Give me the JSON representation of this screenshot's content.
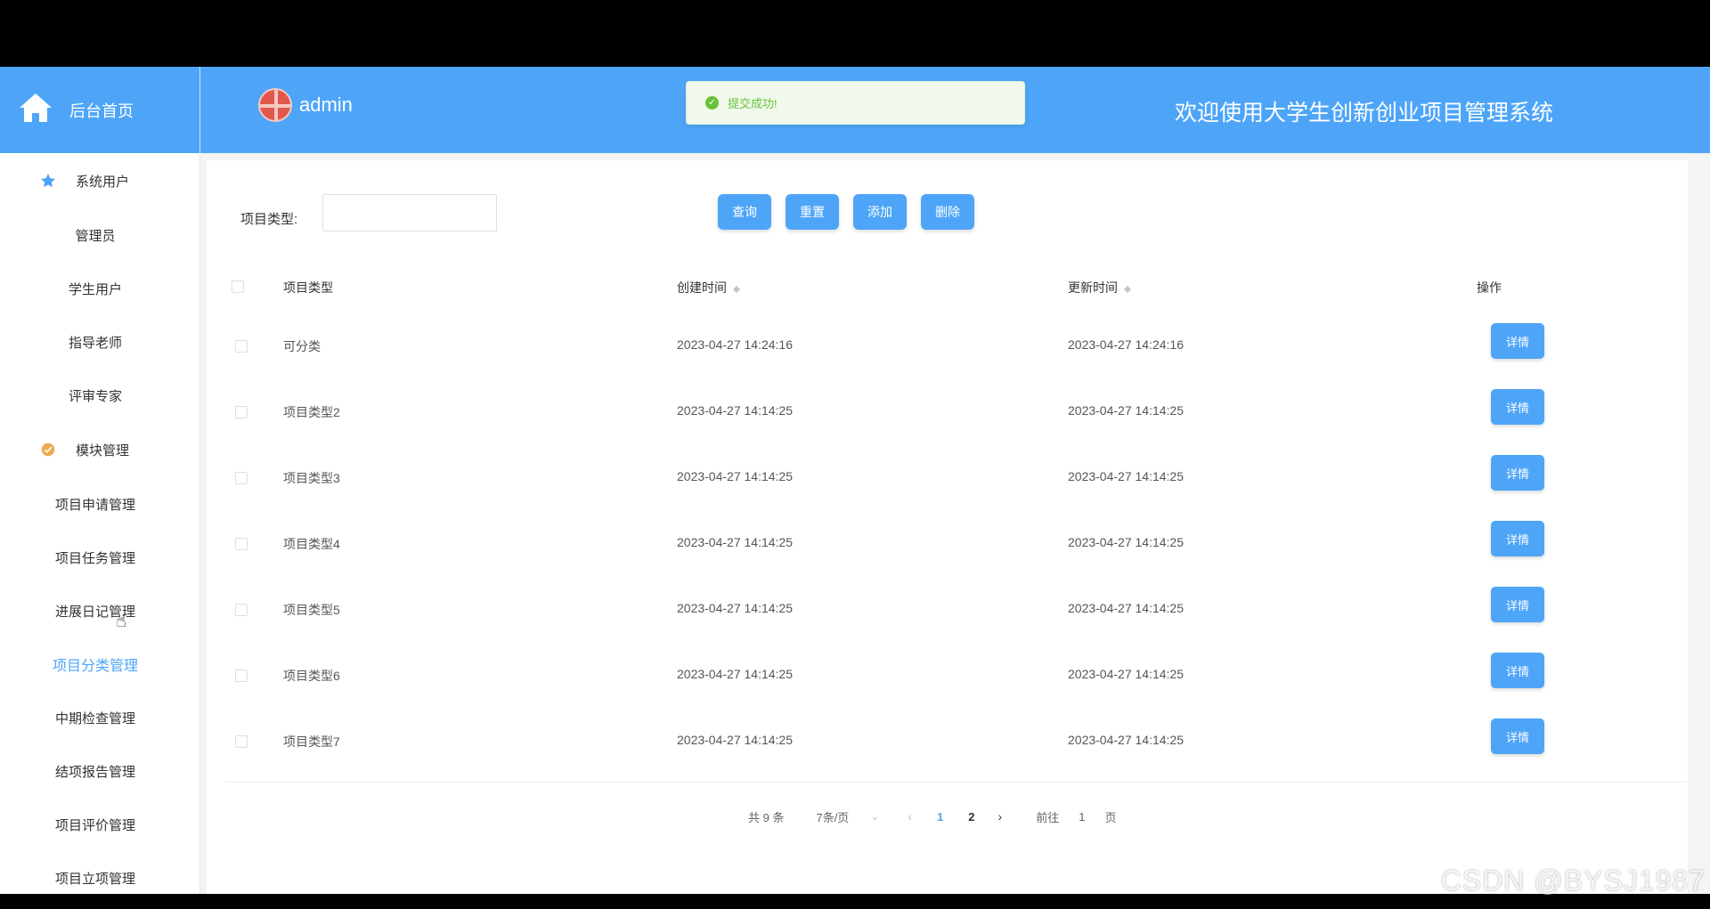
{
  "header": {
    "home_label": "后台首页",
    "username": "admin",
    "system_title": "欢迎使用大学生创新创业项目管理系统",
    "toast_message": "提交成功!"
  },
  "sidebar": {
    "groups": [
      {
        "label": "系统用户",
        "icon": "star-icon",
        "items": [
          "管理员",
          "学生用户",
          "指导老师",
          "评审专家"
        ]
      },
      {
        "label": "模块管理",
        "icon": "badge-icon",
        "items": [
          "项目申请管理",
          "项目任务管理",
          "进展日记管理",
          "项目分类管理",
          "中期检查管理",
          "结项报告管理",
          "项目评价管理",
          "项目立项管理"
        ]
      }
    ],
    "active_item": "项目分类管理"
  },
  "search": {
    "label": "项目类型:",
    "value": "",
    "placeholder": ""
  },
  "toolbar": {
    "query_label": "查询",
    "reset_label": "重置",
    "add_label": "添加",
    "delete_label": "删除"
  },
  "table": {
    "headers": [
      "项目类型",
      "创建时间",
      "更新时间",
      "操作"
    ],
    "rows": [
      {
        "type": "可分类",
        "created": "2023-04-27 14:24:16",
        "updated": "2023-04-27 14:24:16",
        "action": "详情"
      },
      {
        "type": "项目类型2",
        "created": "2023-04-27 14:14:25",
        "updated": "2023-04-27 14:14:25",
        "action": "详情"
      },
      {
        "type": "项目类型3",
        "created": "2023-04-27 14:14:25",
        "updated": "2023-04-27 14:14:25",
        "action": "详情"
      },
      {
        "type": "项目类型4",
        "created": "2023-04-27 14:14:25",
        "updated": "2023-04-27 14:14:25",
        "action": "详情"
      },
      {
        "type": "项目类型5",
        "created": "2023-04-27 14:14:25",
        "updated": "2023-04-27 14:14:25",
        "action": "详情"
      },
      {
        "type": "项目类型6",
        "created": "2023-04-27 14:14:25",
        "updated": "2023-04-27 14:14:25",
        "action": "详情"
      },
      {
        "type": "项目类型7",
        "created": "2023-04-27 14:14:25",
        "updated": "2023-04-27 14:14:25",
        "action": "详情"
      }
    ]
  },
  "pagination": {
    "total": "共 9 条",
    "page_size": "7条/页",
    "pages": [
      "1",
      "2"
    ],
    "current_page": "1",
    "goto_label": "前往",
    "goto_value": "1",
    "goto_suffix": "页"
  },
  "watermark": "CSDN @BYSJ1987",
  "colors": {
    "primary": "#4ea5f8",
    "success": "#67c23a"
  }
}
